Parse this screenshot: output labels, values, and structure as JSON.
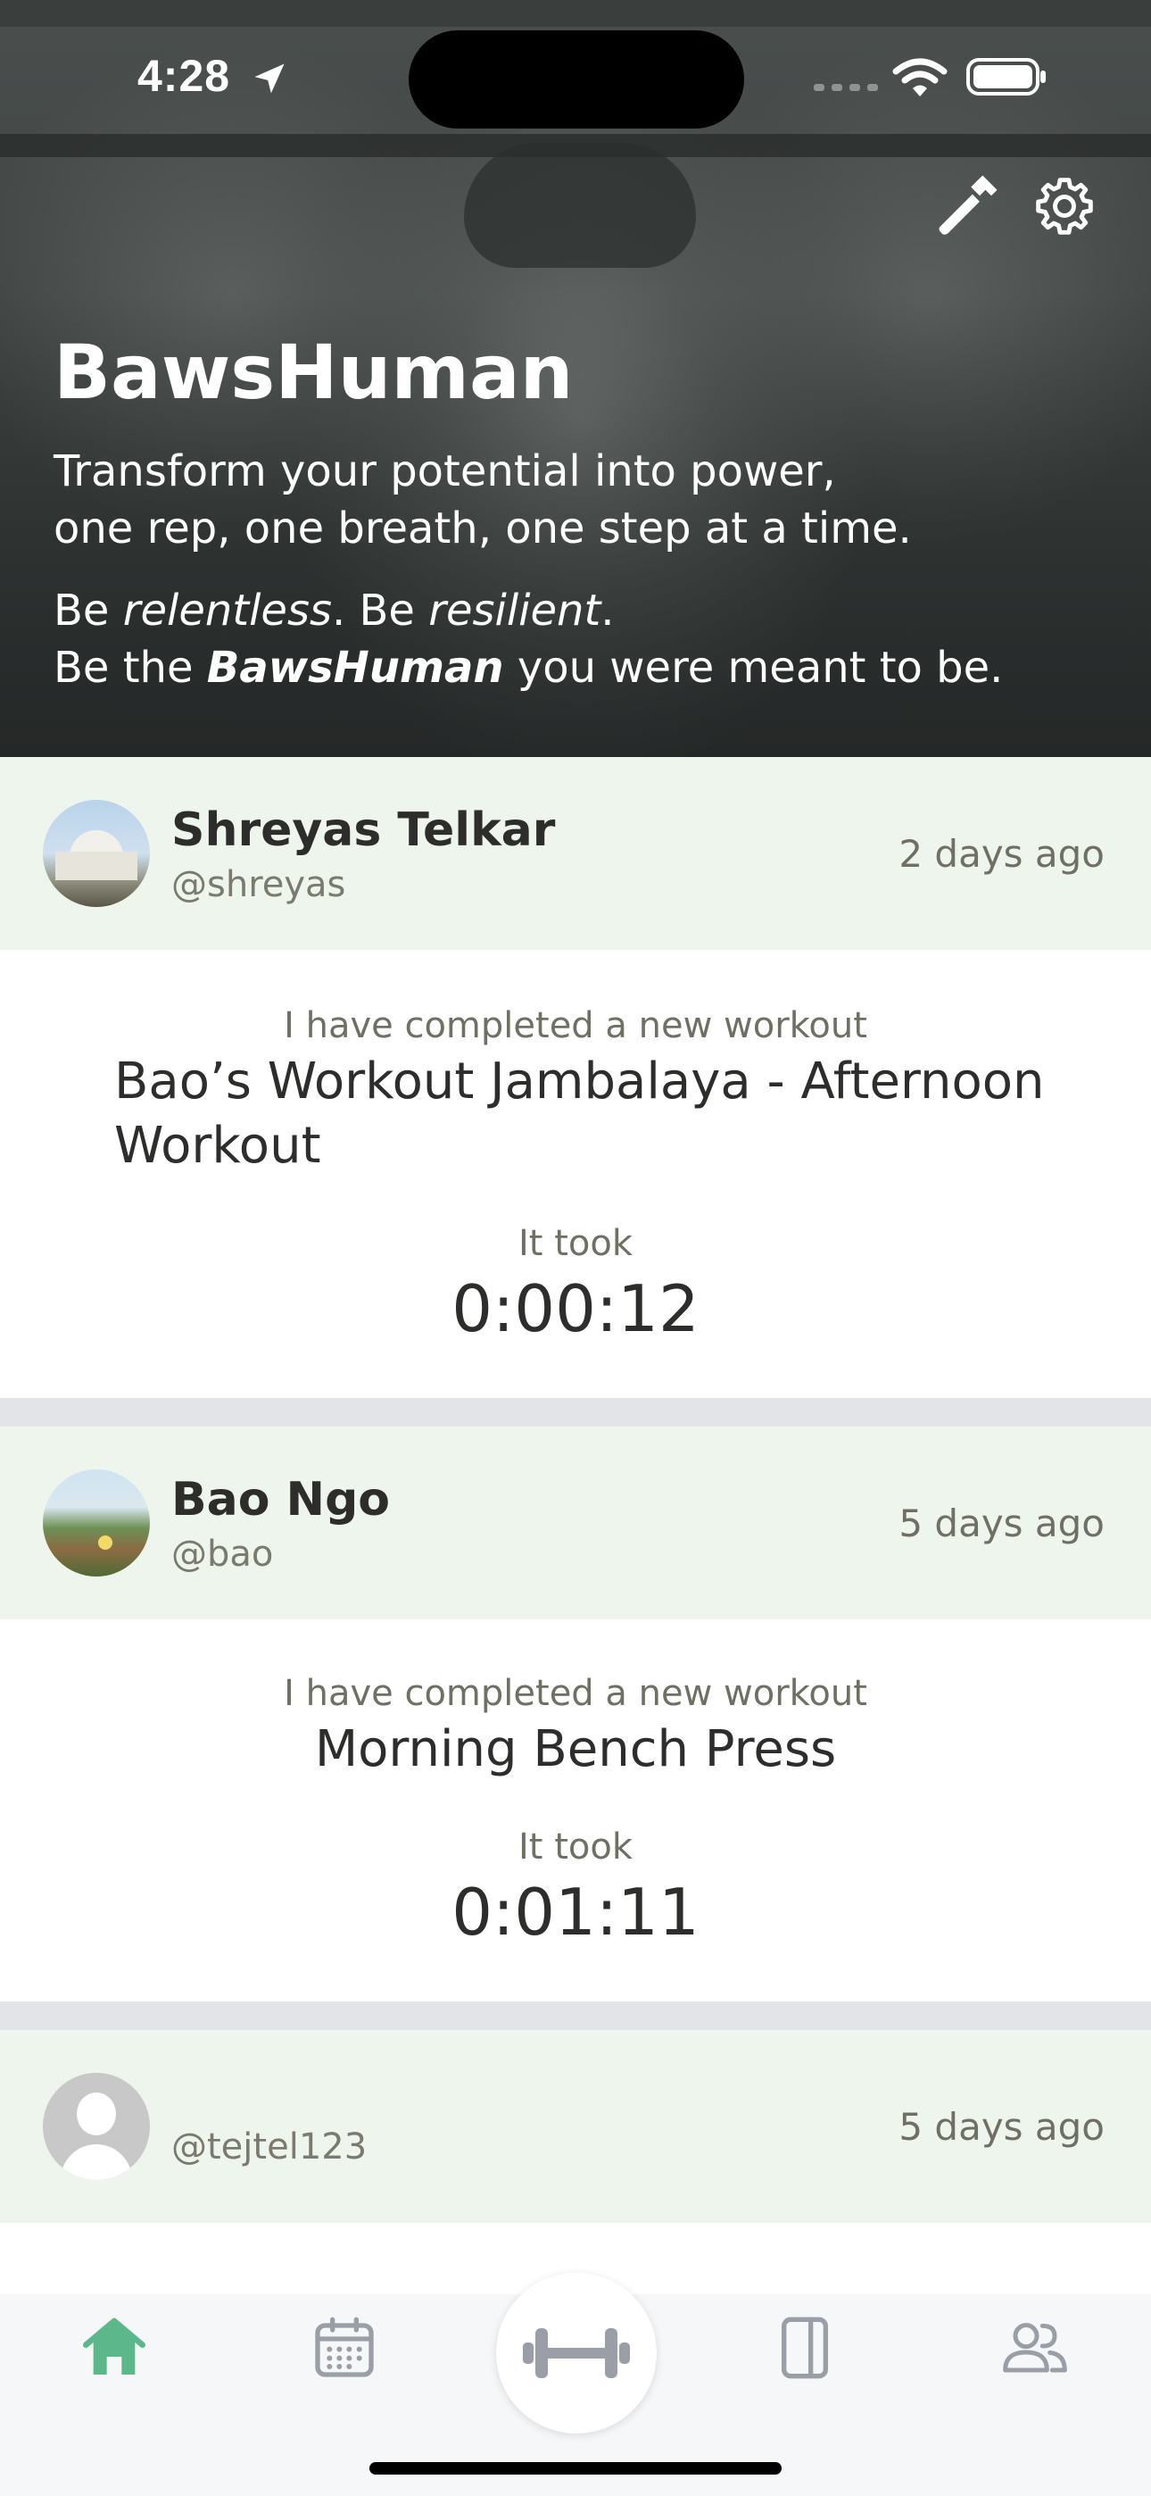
{
  "status_bar": {
    "time": "4:28"
  },
  "hero": {
    "title": "BawsHuman",
    "tagline_line1": "Transform your potential into power,",
    "tagline_line2": "one rep, one breath, one step at a time.",
    "motto_be1": "Be ",
    "motto_relentless": "relentless",
    "motto_be2": ". Be ",
    "motto_resilient": "resilient",
    "motto_dot": ".",
    "motto_be_the": "Be the ",
    "motto_brand": "BawsHuman",
    "motto_end": " you were meant to be."
  },
  "feed": {
    "posts": [
      {
        "name": "Shreyas Telkar",
        "handle": "@shreyas",
        "time_ago": "2 days ago",
        "completed_label": "I have completed a new workout",
        "workout_title": "Bao’s Workout Jambalaya - Afternoon Workout",
        "took_label": "It took",
        "duration": "0:00:12"
      },
      {
        "name": "Bao Ngo",
        "handle": "@bao",
        "time_ago": "5 days ago",
        "completed_label": "I have completed a new workout",
        "workout_title": "Morning Bench Press",
        "took_label": "It took",
        "duration": "0:01:11"
      },
      {
        "name": "",
        "handle": "@tejtel123",
        "time_ago": "5 days ago"
      }
    ]
  },
  "tabbar": {
    "active_color": "#5cb88a",
    "inactive_color": "#9a9ea6",
    "items": [
      "home-icon",
      "calendar-icon",
      "dumbbell-icon",
      "journal-icon",
      "community-icon"
    ]
  }
}
